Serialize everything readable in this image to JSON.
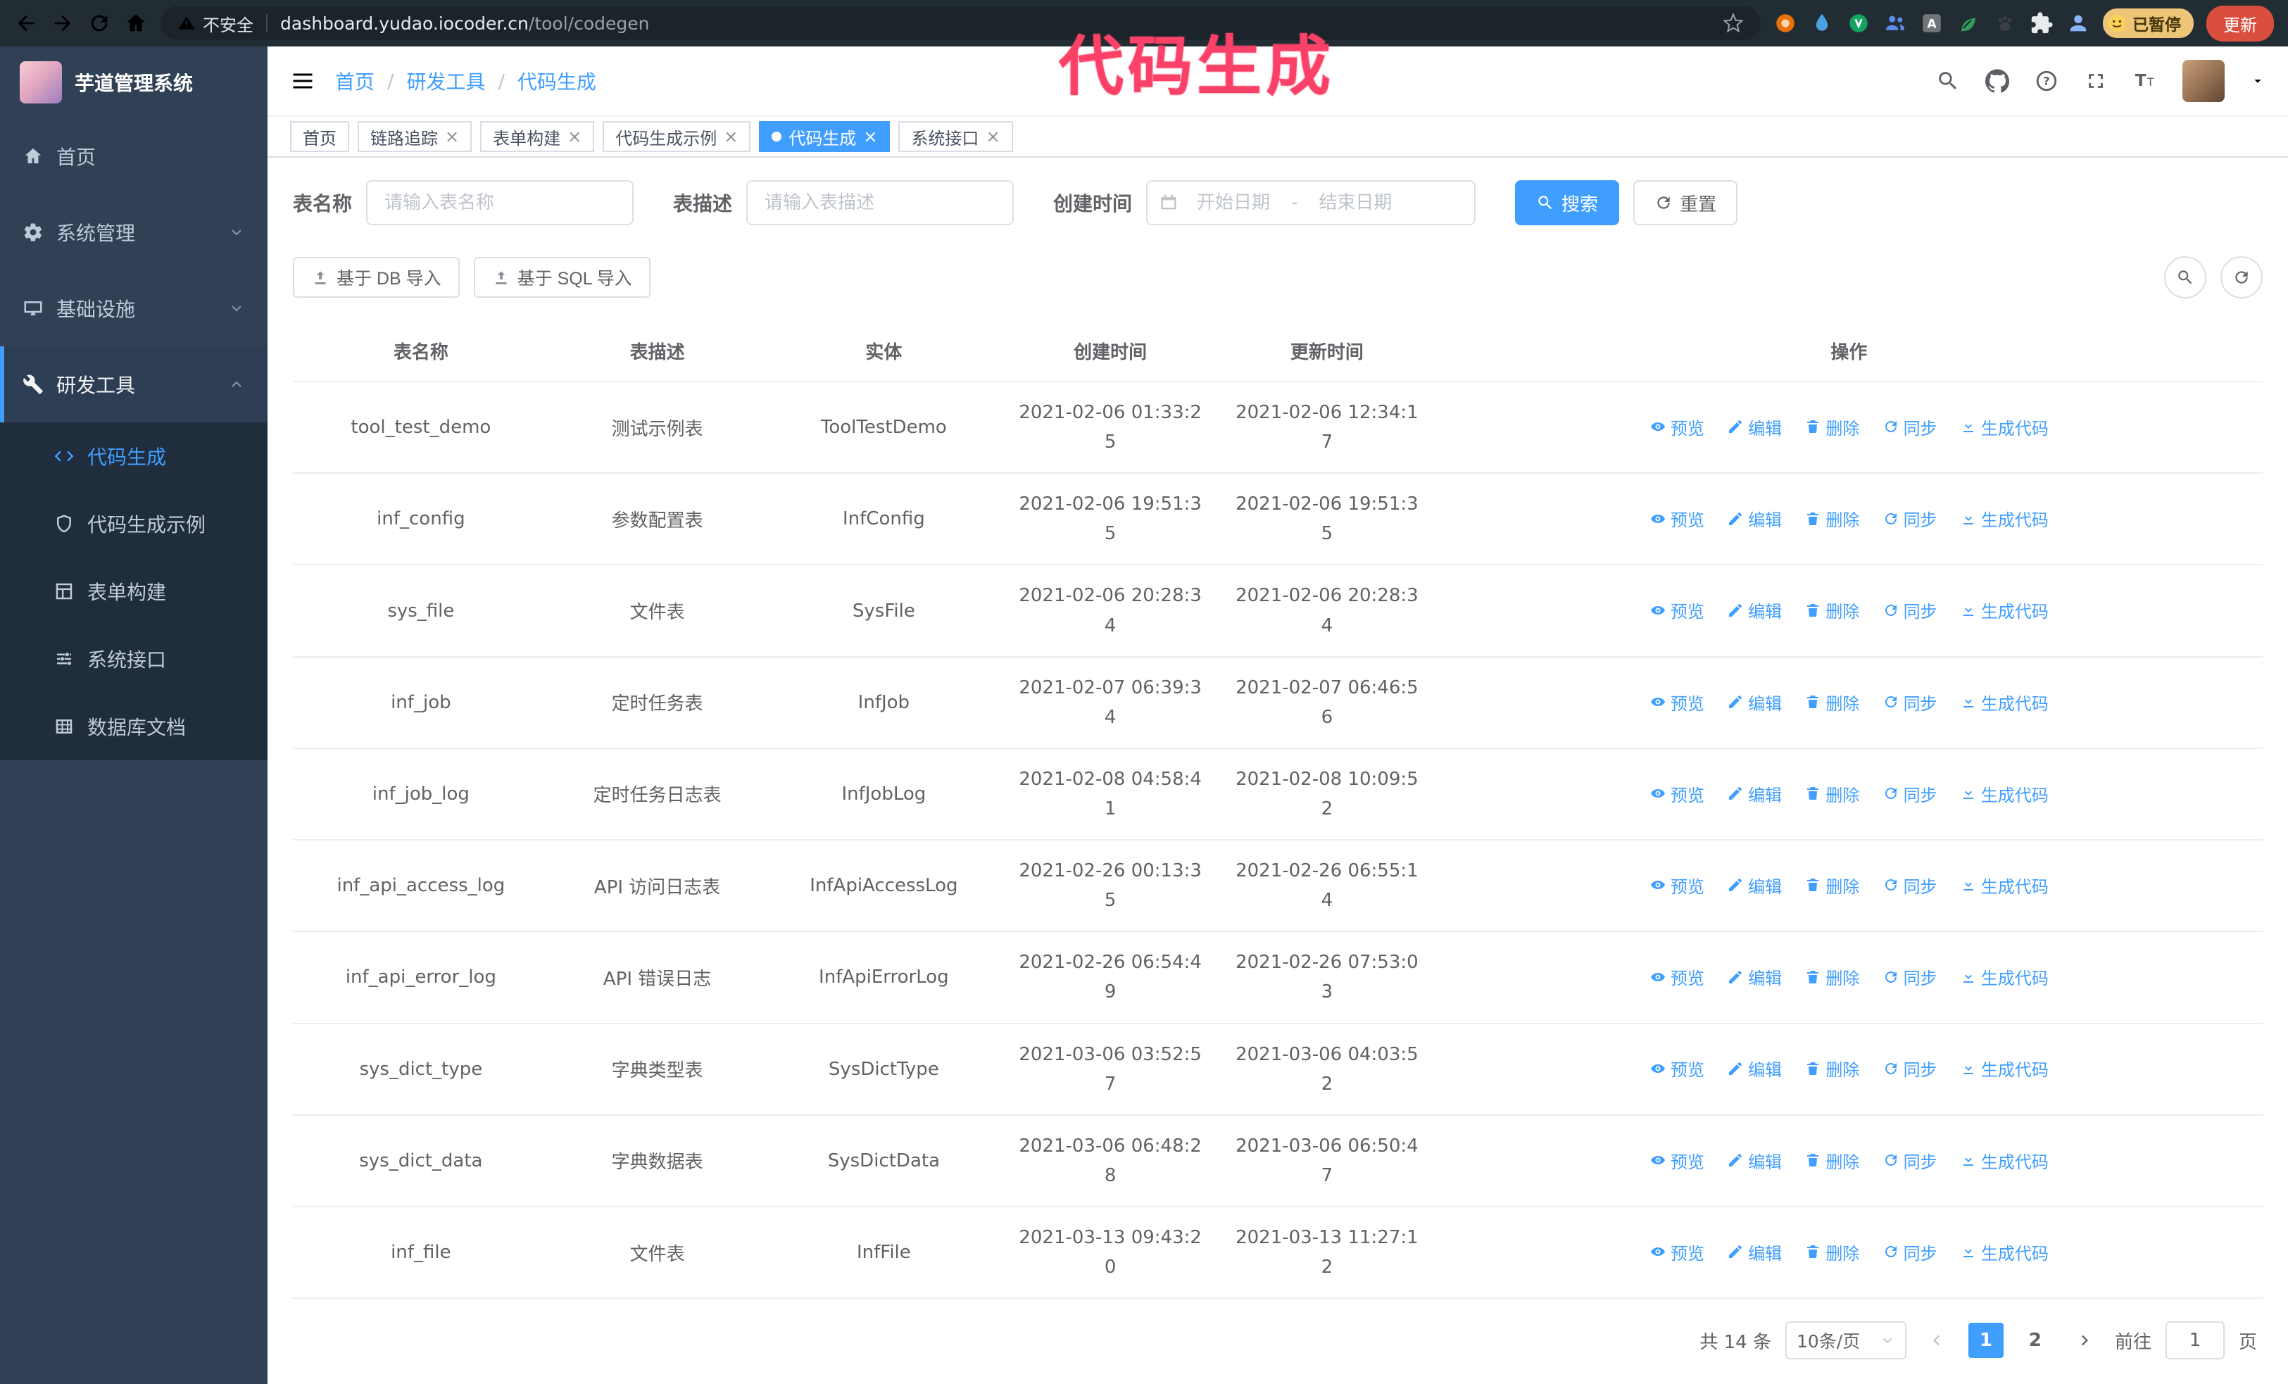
{
  "colors": {
    "accent": "#409eff",
    "annotation": "#fb4168",
    "sidebar_bg": "#304156",
    "update_button_bg": "#da4e3e",
    "active_tab_bg": "#409eff"
  },
  "annotation": {
    "text": "代码生成"
  },
  "browser": {
    "security_label": "不安全",
    "url_host": "dashboard.yudao.iocoder.cn",
    "url_path": "/tool/codegen",
    "paused_badge": "已暂停",
    "update_button": "更新"
  },
  "sidebar": {
    "app_title": "芋道管理系统",
    "items": [
      {
        "label": "首页"
      },
      {
        "label": "系统管理",
        "expandable": true
      },
      {
        "label": "基础设施",
        "expandable": true
      },
      {
        "label": "研发工具",
        "expandable": true,
        "expanded": true
      }
    ],
    "sub_items": [
      {
        "label": "代码生成",
        "active": true
      },
      {
        "label": "代码生成示例"
      },
      {
        "label": "表单构建"
      },
      {
        "label": "系统接口"
      },
      {
        "label": "数据库文档"
      }
    ]
  },
  "header": {
    "breadcrumb": [
      "首页",
      "研发工具",
      "代码生成"
    ]
  },
  "tabs": [
    {
      "label": "首页",
      "closable": false,
      "active": false
    },
    {
      "label": "链路追踪",
      "closable": true,
      "active": false
    },
    {
      "label": "表单构建",
      "closable": true,
      "active": false
    },
    {
      "label": "代码生成示例",
      "closable": true,
      "active": false
    },
    {
      "label": "代码生成",
      "closable": true,
      "active": true
    },
    {
      "label": "系统接口",
      "closable": true,
      "active": false
    }
  ],
  "filters": {
    "table_name_label": "表名称",
    "table_name_placeholder": "请输入表名称",
    "table_desc_label": "表描述",
    "table_desc_placeholder": "请输入表描述",
    "create_time_label": "创建时间",
    "date_start_placeholder": "开始日期",
    "date_separator": "-",
    "date_end_placeholder": "结束日期",
    "search_button": "搜索",
    "reset_button": "重置"
  },
  "toolbar": {
    "import_db_button": "基于 DB 导入",
    "import_sql_button": "基于 SQL 导入"
  },
  "table": {
    "columns": [
      "表名称",
      "表描述",
      "实体",
      "创建时间",
      "更新时间",
      "操作"
    ],
    "actions": [
      "预览",
      "编辑",
      "删除",
      "同步",
      "生成代码"
    ],
    "rows": [
      {
        "name": "tool_test_demo",
        "desc": "测试示例表",
        "entity": "ToolTestDemo",
        "created": "2021-02-06 01:33:25",
        "updated": "2021-02-06 12:34:17"
      },
      {
        "name": "inf_config",
        "desc": "参数配置表",
        "entity": "InfConfig",
        "created": "2021-02-06 19:51:35",
        "updated": "2021-02-06 19:51:35"
      },
      {
        "name": "sys_file",
        "desc": "文件表",
        "entity": "SysFile",
        "created": "2021-02-06 20:28:34",
        "updated": "2021-02-06 20:28:34"
      },
      {
        "name": "inf_job",
        "desc": "定时任务表",
        "entity": "InfJob",
        "created": "2021-02-07 06:39:34",
        "updated": "2021-02-07 06:46:56"
      },
      {
        "name": "inf_job_log",
        "desc": "定时任务日志表",
        "entity": "InfJobLog",
        "created": "2021-02-08 04:58:41",
        "updated": "2021-02-08 10:09:52"
      },
      {
        "name": "inf_api_access_log",
        "desc": "API 访问日志表",
        "entity": "InfApiAccessLog",
        "created": "2021-02-26 00:13:35",
        "updated": "2021-02-26 06:55:14"
      },
      {
        "name": "inf_api_error_log",
        "desc": "API 错误日志",
        "entity": "InfApiErrorLog",
        "created": "2021-02-26 06:54:49",
        "updated": "2021-02-26 07:53:03"
      },
      {
        "name": "sys_dict_type",
        "desc": "字典类型表",
        "entity": "SysDictType",
        "created": "2021-03-06 03:52:57",
        "updated": "2021-03-06 04:03:52"
      },
      {
        "name": "sys_dict_data",
        "desc": "字典数据表",
        "entity": "SysDictData",
        "created": "2021-03-06 06:48:28",
        "updated": "2021-03-06 06:50:47"
      },
      {
        "name": "inf_file",
        "desc": "文件表",
        "entity": "InfFile",
        "created": "2021-03-13 09:43:20",
        "updated": "2021-03-13 11:27:12"
      }
    ]
  },
  "pagination": {
    "total": "共 14 条",
    "page_size": "10条/页",
    "pages": [
      "1",
      "2"
    ],
    "current": "1",
    "goto_label": "前往",
    "goto_value": "1",
    "page_label": "页"
  }
}
